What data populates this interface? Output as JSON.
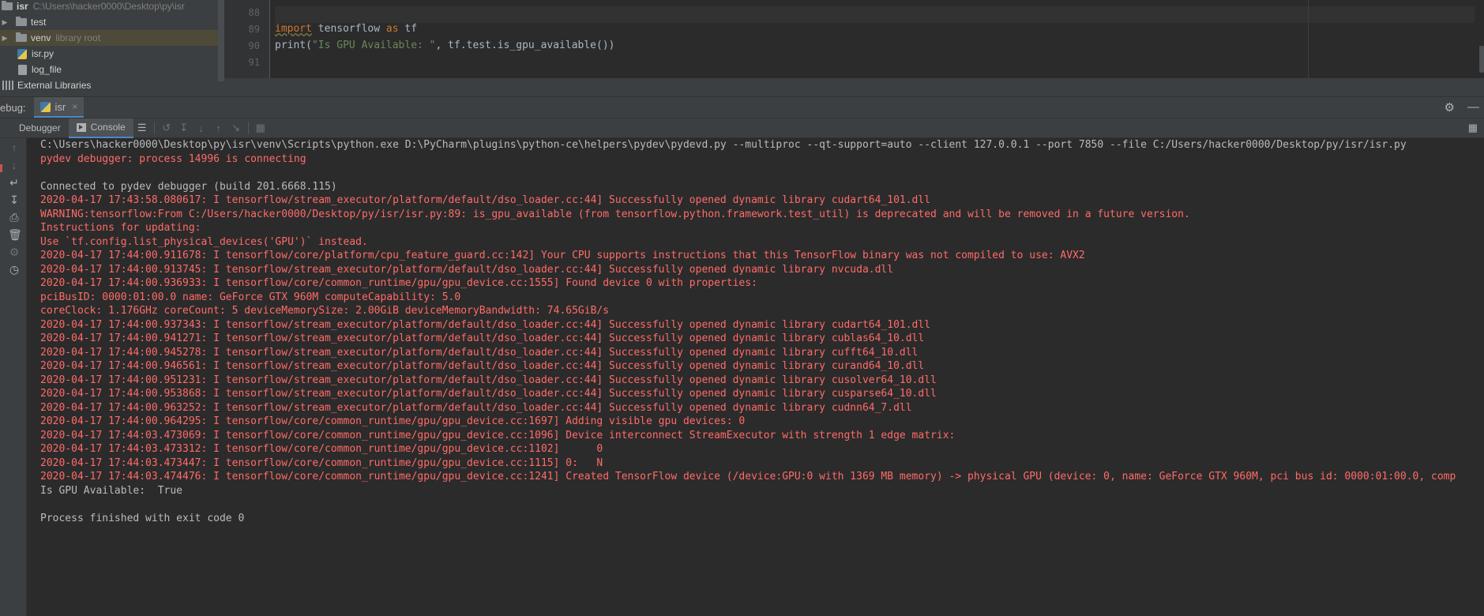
{
  "project_tree": {
    "root": {
      "name": "isr",
      "path": "C:\\Users\\hacker0000\\Desktop\\py\\isr"
    },
    "items": [
      {
        "name": "test",
        "hint": "",
        "kind": "folder",
        "expandable": true
      },
      {
        "name": "venv",
        "hint": "library root",
        "kind": "folder",
        "expandable": true
      },
      {
        "name": "isr.py",
        "hint": "",
        "kind": "python-file",
        "expandable": false
      },
      {
        "name": "log_file",
        "hint": "",
        "kind": "text-file",
        "expandable": false
      },
      {
        "name": "External Libraries",
        "hint": "",
        "kind": "libraries",
        "expandable": true
      }
    ]
  },
  "editor": {
    "line_numbers": [
      "88",
      "89",
      "90",
      "91"
    ],
    "lines": [
      {
        "parts": []
      },
      {
        "parts": [
          {
            "t": "import",
            "c": "kw underlined"
          },
          {
            "t": " tensorflow ",
            "c": ""
          },
          {
            "t": "as",
            "c": "kw"
          },
          {
            "t": " tf",
            "c": ""
          }
        ]
      },
      {
        "parts": [
          {
            "t": "print(",
            "c": ""
          },
          {
            "t": "\"Is GPU Available: \"",
            "c": "str"
          },
          {
            "t": ", tf.test.is_gpu_available())",
            "c": ""
          }
        ]
      },
      {
        "parts": []
      }
    ]
  },
  "debug_window": {
    "label": "ebug:",
    "tab_label": "isr",
    "tab_close": "×",
    "header_icons": [
      "gear-icon",
      "minimize-icon"
    ],
    "subtabs": {
      "debugger": "Debugger",
      "console": "Console"
    }
  },
  "console": {
    "lines": [
      {
        "text": "C:\\Users\\hacker0000\\Desktop\\py\\isr\\venv\\Scripts\\python.exe D:\\PyCharm\\plugins\\python-ce\\helpers\\pydev\\pydevd.py --multiproc --qt-support=auto --client 127.0.0.1 --port 7850 --file C:/Users/hacker0000/Desktop/py/isr/isr.py",
        "style": "normal"
      },
      {
        "text": "pydev debugger: process 14996 is connecting",
        "style": "error"
      },
      {
        "text": "",
        "style": "normal"
      },
      {
        "text": "Connected to pydev debugger (build 201.6668.115)",
        "style": "normal"
      },
      {
        "text": "2020-04-17 17:43:58.080617: I tensorflow/stream_executor/platform/default/dso_loader.cc:44] Successfully opened dynamic library cudart64_101.dll",
        "style": "error"
      },
      {
        "text": "WARNING:tensorflow:From C:/Users/hacker0000/Desktop/py/isr/isr.py:89: is_gpu_available (from tensorflow.python.framework.test_util) is deprecated and will be removed in a future version.",
        "style": "error"
      },
      {
        "text": "Instructions for updating:",
        "style": "error"
      },
      {
        "text": "Use `tf.config.list_physical_devices('GPU')` instead.",
        "style": "error"
      },
      {
        "text": "2020-04-17 17:44:00.911678: I tensorflow/core/platform/cpu_feature_guard.cc:142] Your CPU supports instructions that this TensorFlow binary was not compiled to use: AVX2",
        "style": "error"
      },
      {
        "text": "2020-04-17 17:44:00.913745: I tensorflow/stream_executor/platform/default/dso_loader.cc:44] Successfully opened dynamic library nvcuda.dll",
        "style": "error"
      },
      {
        "text": "2020-04-17 17:44:00.936933: I tensorflow/core/common_runtime/gpu/gpu_device.cc:1555] Found device 0 with properties:",
        "style": "error"
      },
      {
        "text": "pciBusID: 0000:01:00.0 name: GeForce GTX 960M computeCapability: 5.0",
        "style": "error"
      },
      {
        "text": "coreClock: 1.176GHz coreCount: 5 deviceMemorySize: 2.00GiB deviceMemoryBandwidth: 74.65GiB/s",
        "style": "error"
      },
      {
        "text": "2020-04-17 17:44:00.937343: I tensorflow/stream_executor/platform/default/dso_loader.cc:44] Successfully opened dynamic library cudart64_101.dll",
        "style": "error"
      },
      {
        "text": "2020-04-17 17:44:00.941271: I tensorflow/stream_executor/platform/default/dso_loader.cc:44] Successfully opened dynamic library cublas64_10.dll",
        "style": "error"
      },
      {
        "text": "2020-04-17 17:44:00.945278: I tensorflow/stream_executor/platform/default/dso_loader.cc:44] Successfully opened dynamic library cufft64_10.dll",
        "style": "error"
      },
      {
        "text": "2020-04-17 17:44:00.946561: I tensorflow/stream_executor/platform/default/dso_loader.cc:44] Successfully opened dynamic library curand64_10.dll",
        "style": "error"
      },
      {
        "text": "2020-04-17 17:44:00.951231: I tensorflow/stream_executor/platform/default/dso_loader.cc:44] Successfully opened dynamic library cusolver64_10.dll",
        "style": "error"
      },
      {
        "text": "2020-04-17 17:44:00.953868: I tensorflow/stream_executor/platform/default/dso_loader.cc:44] Successfully opened dynamic library cusparse64_10.dll",
        "style": "error"
      },
      {
        "text": "2020-04-17 17:44:00.963252: I tensorflow/stream_executor/platform/default/dso_loader.cc:44] Successfully opened dynamic library cudnn64_7.dll",
        "style": "error"
      },
      {
        "text": "2020-04-17 17:44:00.964295: I tensorflow/core/common_runtime/gpu/gpu_device.cc:1697] Adding visible gpu devices: 0",
        "style": "error"
      },
      {
        "text": "2020-04-17 17:44:03.473069: I tensorflow/core/common_runtime/gpu/gpu_device.cc:1096] Device interconnect StreamExecutor with strength 1 edge matrix:",
        "style": "error"
      },
      {
        "text": "2020-04-17 17:44:03.473312: I tensorflow/core/common_runtime/gpu/gpu_device.cc:1102]      0",
        "style": "error"
      },
      {
        "text": "2020-04-17 17:44:03.473447: I tensorflow/core/common_runtime/gpu/gpu_device.cc:1115] 0:   N",
        "style": "error"
      },
      {
        "text": "2020-04-17 17:44:03.474476: I tensorflow/core/common_runtime/gpu/gpu_device.cc:1241] Created TensorFlow device (/device:GPU:0 with 1369 MB memory) -> physical GPU (device: 0, name: GeForce GTX 960M, pci bus id: 0000:01:00.0, comp",
        "style": "error"
      },
      {
        "text": "Is GPU Available:  True",
        "style": "normal"
      },
      {
        "text": "",
        "style": "normal"
      },
      {
        "text": "Process finished with exit code 0",
        "style": "normal"
      }
    ]
  },
  "colors": {
    "background": "#2b2b2b",
    "panel": "#3c3f41",
    "stderr_text": "#ff6b68",
    "stdout_text": "#bbbbbb",
    "keyword": "#cc7832",
    "string": "#6a8759",
    "selection": "#4e4a3a",
    "tab_underline": "#4a88c7"
  }
}
